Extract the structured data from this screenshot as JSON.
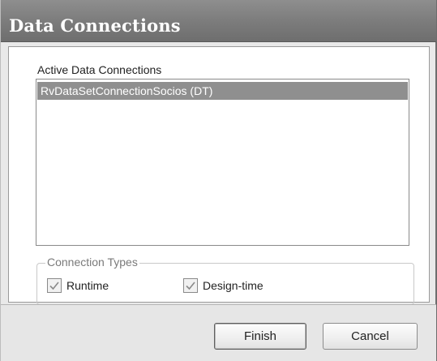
{
  "window": {
    "title": "Data Connections"
  },
  "connections": {
    "label": "Active Data Connections",
    "items": [
      {
        "label": "RvDataSetConnectionSocios (DT)",
        "selected": true
      }
    ]
  },
  "connection_types": {
    "legend": "Connection Types",
    "runtime": {
      "label": "Runtime",
      "checked": true
    },
    "design_time": {
      "label": "Design-time",
      "checked": true
    }
  },
  "buttons": {
    "finish": "Finish",
    "cancel": "Cancel"
  },
  "icons": {
    "checkmark": "checkmark-icon"
  },
  "colors": {
    "titlebar": "#7b7b7b",
    "selection": "#8f8f8f"
  }
}
